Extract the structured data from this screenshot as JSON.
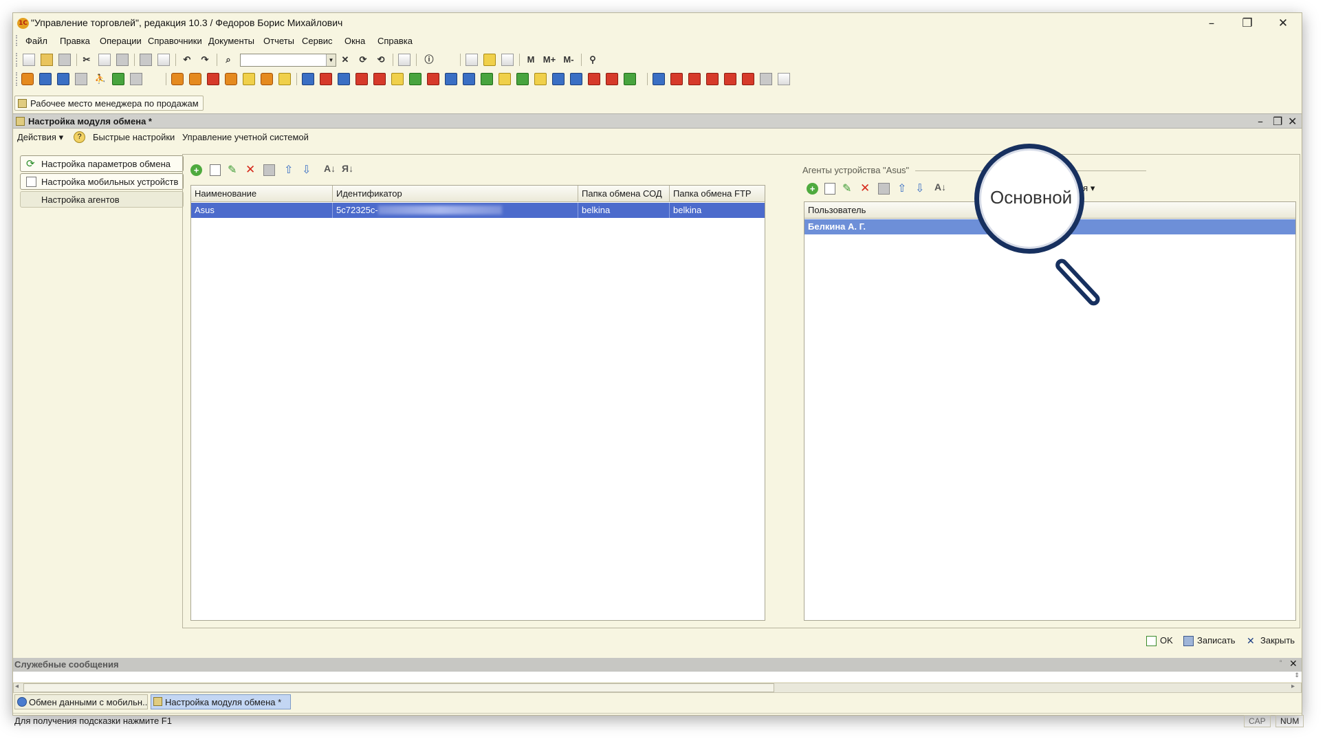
{
  "window": {
    "title": "\"Управление торговлей\", редакция 10.3 / Федоров Борис Михайлович",
    "icon_label": "1С",
    "controls": {
      "minimize": "–",
      "maximize": "❐",
      "close": "✕"
    }
  },
  "menu": [
    "Файл",
    "Правка",
    "Операции",
    "Справочники",
    "Документы",
    "Отчеты",
    "Сервис",
    "Окна",
    "Справка"
  ],
  "toolbar": {
    "m_labels": [
      "M",
      "M+",
      "M-"
    ]
  },
  "workspace_button": "Рабочее место менеджера по продажам",
  "form": {
    "title": "Настройка модуля обмена *",
    "actions": [
      "Действия",
      "Быстрые настройки",
      "Управление учетной системой"
    ],
    "nav": [
      "Настройка параметров обмена",
      "Настройка мобильных устройств",
      "Настройка агентов"
    ]
  },
  "devices": {
    "columns": [
      "Наименование",
      "Идентификатор",
      "Папка обмена СОД",
      "Папка обмена FTP"
    ],
    "rows": [
      {
        "name": "Asus",
        "id": "5c72325c-",
        "sod": "belkina",
        "ftp": "belkina"
      }
    ]
  },
  "agents": {
    "group_title": "Агенты устройства \"Asus\"",
    "magnifier_label": "Основной",
    "actions_tail": "вия",
    "columns": [
      "Пользователь"
    ],
    "rows": [
      {
        "user": "Белкина А. Г."
      }
    ]
  },
  "buttons": {
    "ok": "OK",
    "save": "Записать",
    "close": "Закрыть"
  },
  "messages_panel": {
    "title": "Служебные сообщения"
  },
  "taskbar": [
    "Обмен данными с мобильн...",
    "Настройка модуля обмена *"
  ],
  "status": {
    "hint": "Для получения подсказки нажмите F1",
    "cap": "CAP",
    "num": "NUM"
  },
  "colors": {
    "window_bg": "#f7f5e1",
    "selection": "#4c6bcc",
    "magnifier_ring": "#17305f"
  }
}
